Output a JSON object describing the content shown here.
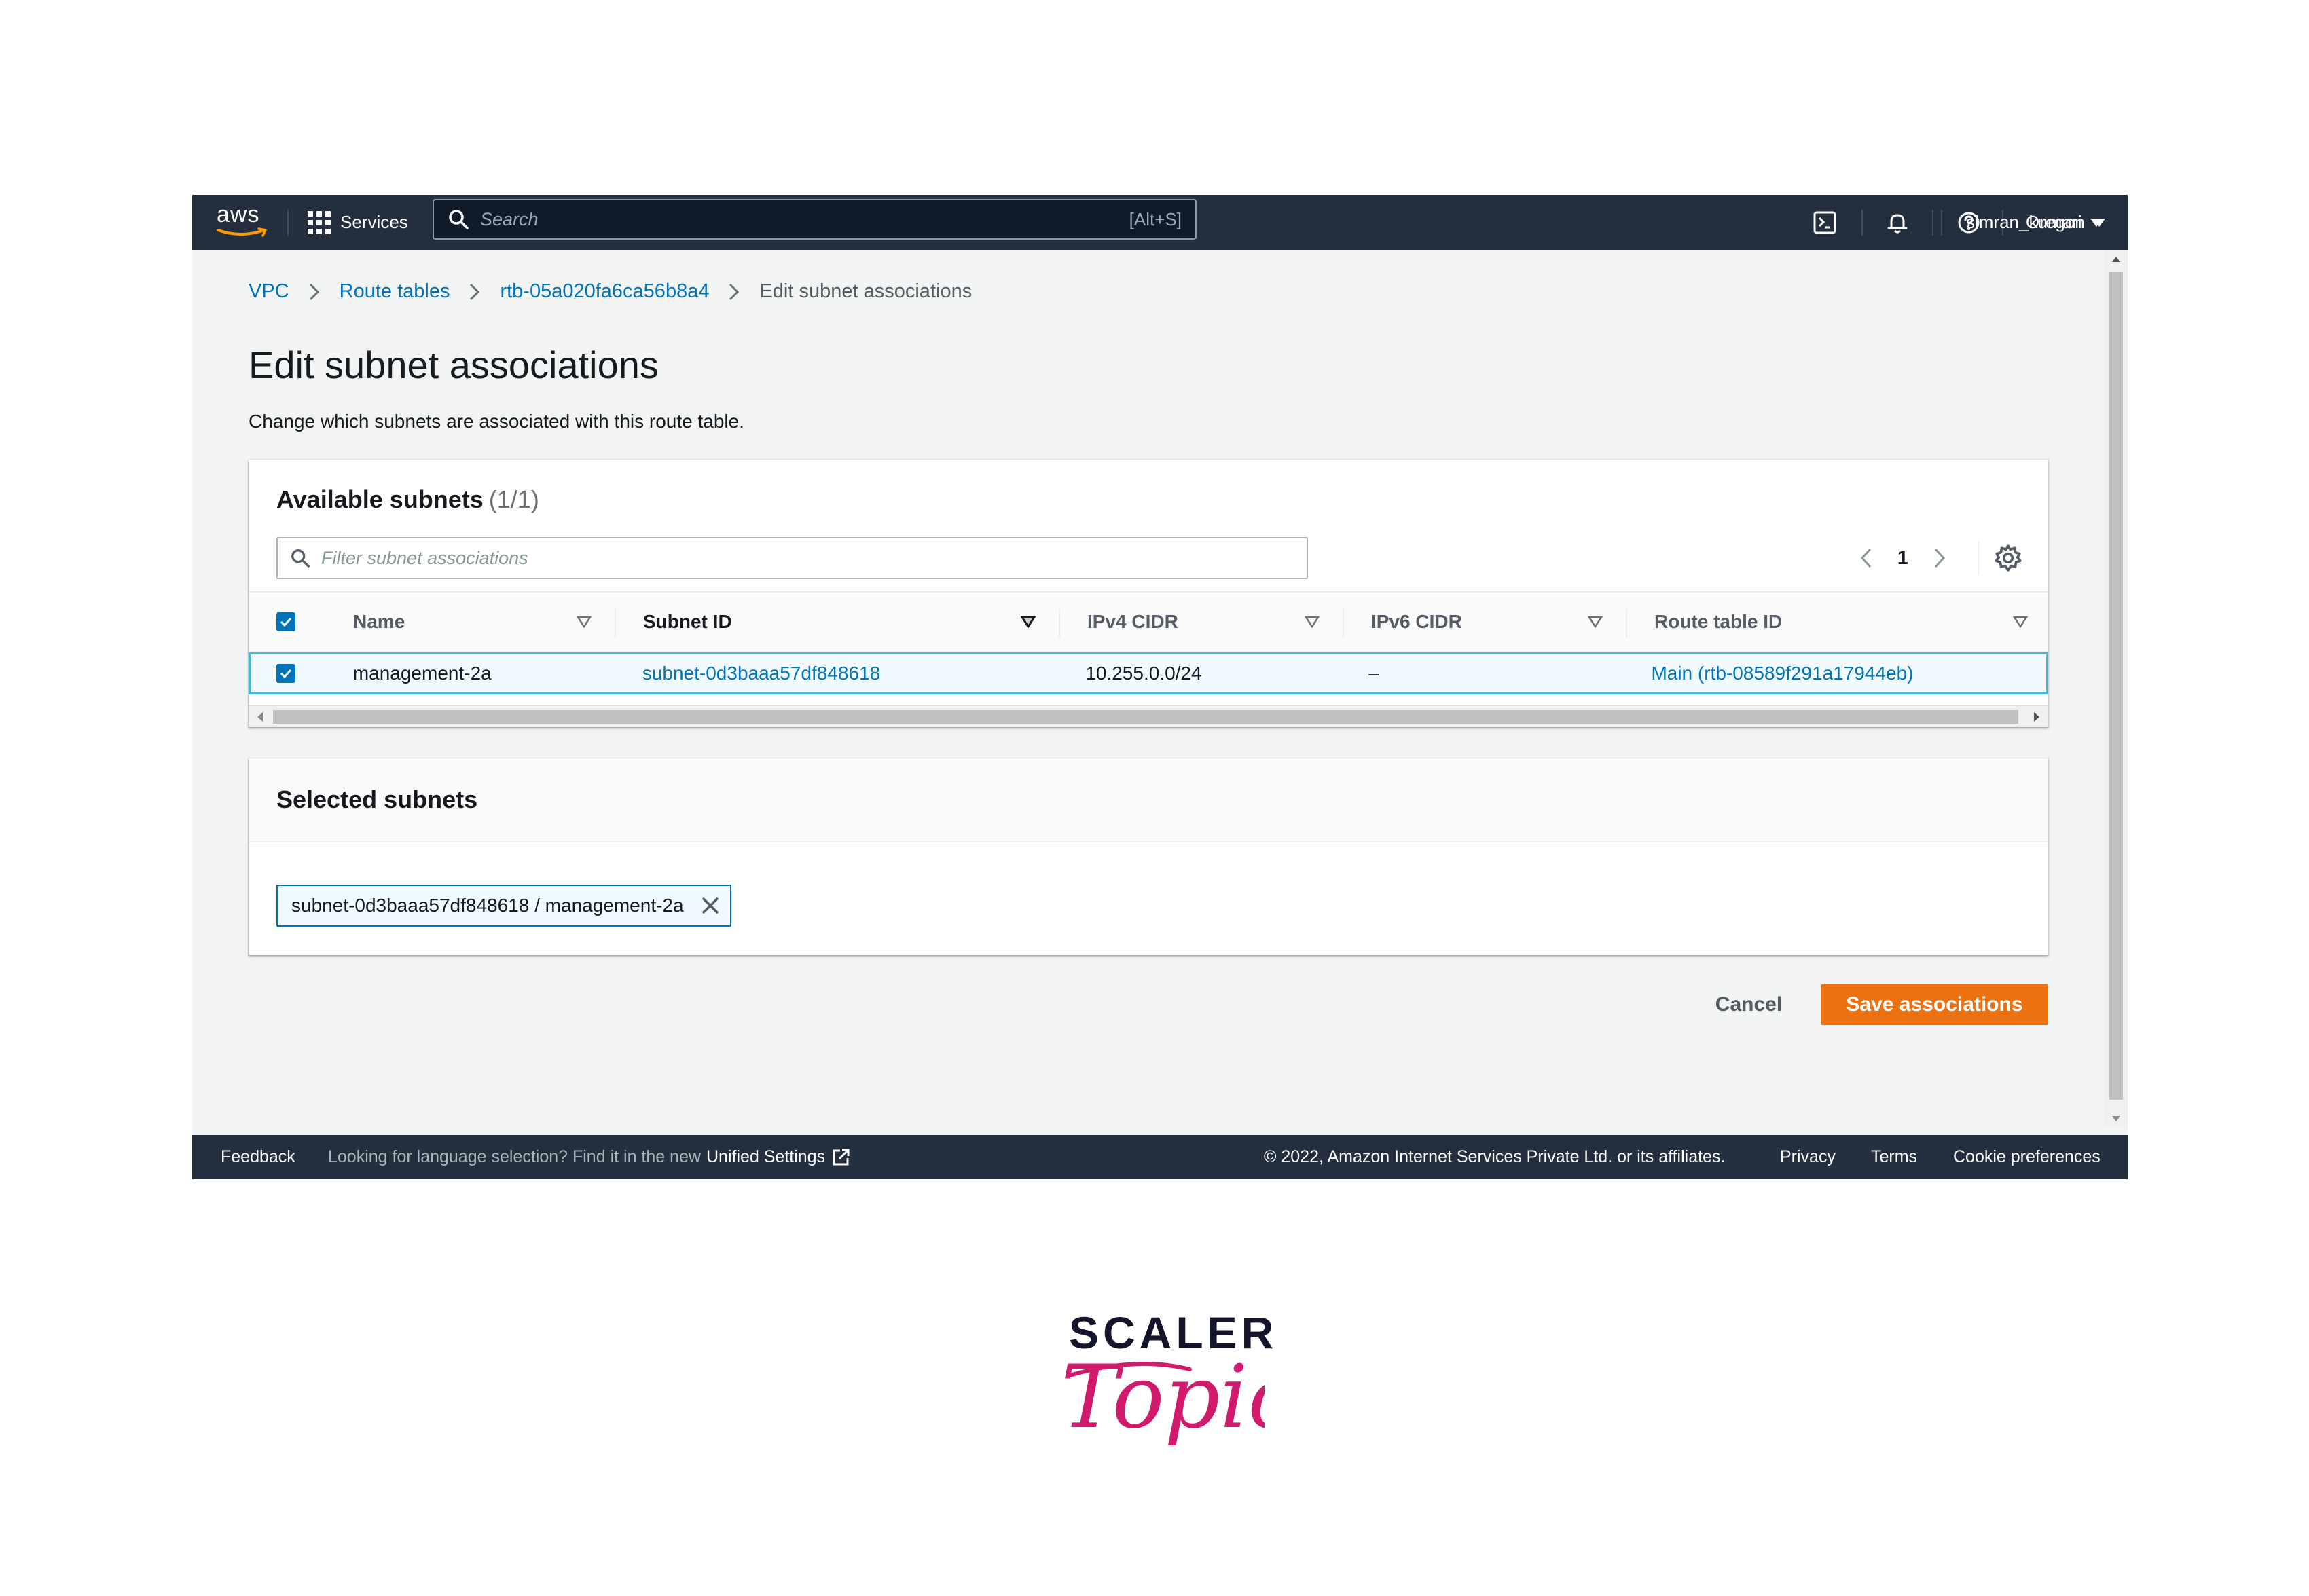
{
  "topnav": {
    "brand": "aws",
    "services_label": "Services",
    "search_placeholder": "Search",
    "search_shortcut": "[Alt+S]",
    "region": "Oregon",
    "user": "simran_kumari"
  },
  "breadcrumb": [
    {
      "label": "VPC"
    },
    {
      "label": "Route tables"
    },
    {
      "label": "rtb-05a020fa6ca56b8a4"
    },
    {
      "label": "Edit subnet associations"
    }
  ],
  "page": {
    "title": "Edit subnet associations",
    "description": "Change which subnets are associated with this route table."
  },
  "available": {
    "title": "Available subnets",
    "count": "(1/1)",
    "filter_placeholder": "Filter subnet associations",
    "page_number": "1",
    "columns": [
      "Name",
      "Subnet ID",
      "IPv4 CIDR",
      "IPv6 CIDR",
      "Route table ID"
    ],
    "rows": [
      {
        "name": "management-2a",
        "subnet_id": "subnet-0d3baaa57df848618",
        "ipv4": "10.255.0.0/24",
        "ipv6": "–",
        "route_table": "Main (rtb-08589f291a17944eb)",
        "selected": true
      }
    ]
  },
  "selected": {
    "title": "Selected subnets",
    "token": "subnet-0d3baaa57df848618 / management-2a"
  },
  "actions": {
    "cancel": "Cancel",
    "save": "Save associations"
  },
  "footer": {
    "feedback": "Feedback",
    "lang_prompt": "Looking for language selection? Find it in the new",
    "unified_settings": "Unified Settings",
    "copyright": "© 2022, Amazon Internet Services Private Ltd. or its affiliates.",
    "privacy": "Privacy",
    "terms": "Terms",
    "cookies": "Cookie preferences"
  },
  "logo": {
    "line1": "SCALER",
    "line2": "Topics"
  },
  "colors": {
    "nav_bg": "#232f3e",
    "link": "#0073bb",
    "primary_button": "#ec7211",
    "selected_row_border": "#44b9d6",
    "scaler_pink": "#d11a6b"
  }
}
